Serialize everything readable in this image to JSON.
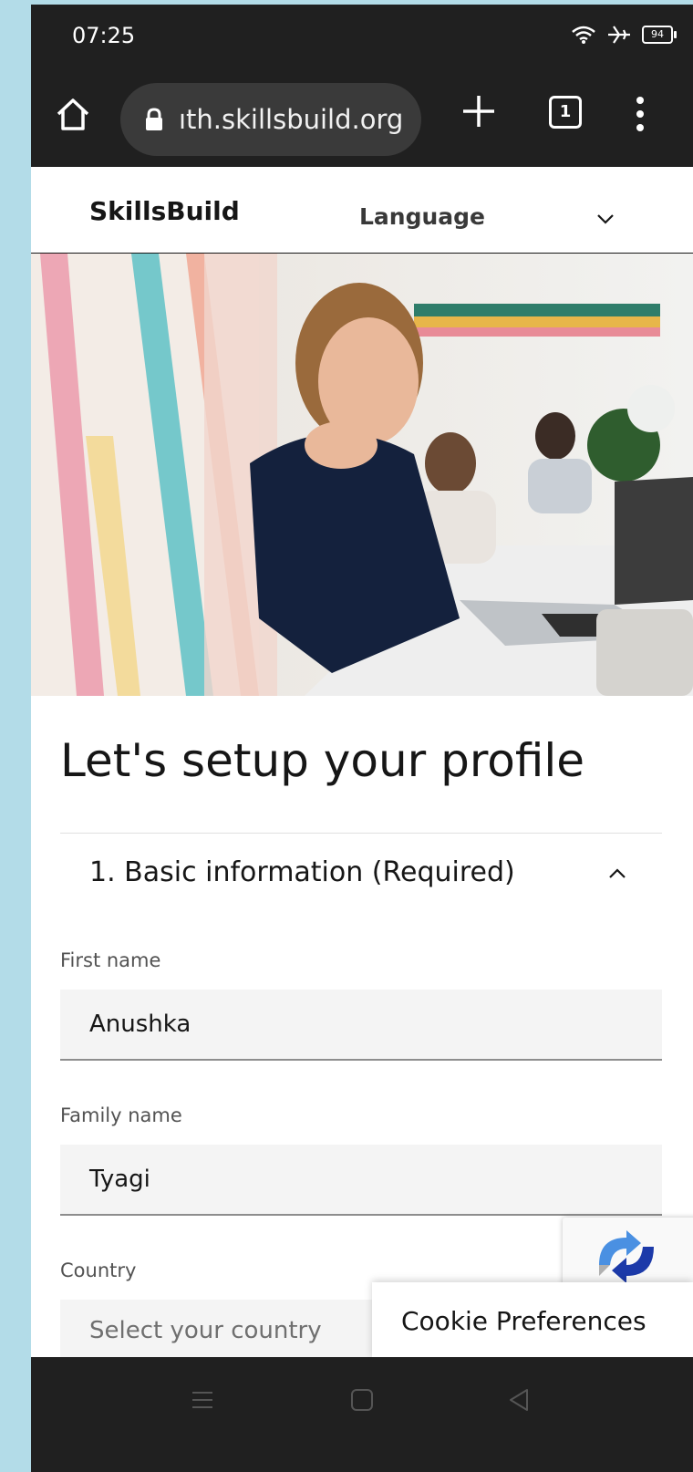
{
  "status_bar": {
    "time": "07:25",
    "battery": "94"
  },
  "browser": {
    "url": "ıth.skillsbuild.org",
    "tab_count": "1"
  },
  "header": {
    "brand": "SkillsBuild",
    "language_label": "Language"
  },
  "page": {
    "title": "Let's setup your profile",
    "section_title": "1. Basic information (Required)"
  },
  "form": {
    "first_name_label": "First name",
    "first_name_value": "Anushka",
    "family_name_label": "Family name",
    "family_name_value": "Tyagi",
    "country_label": "Country",
    "country_placeholder": "Select your country"
  },
  "cookie": {
    "label": "Cookie Preferences"
  },
  "colors": {
    "background": "#b3dce8",
    "chrome": "#202020",
    "field_bg": "#f4f4f4"
  }
}
